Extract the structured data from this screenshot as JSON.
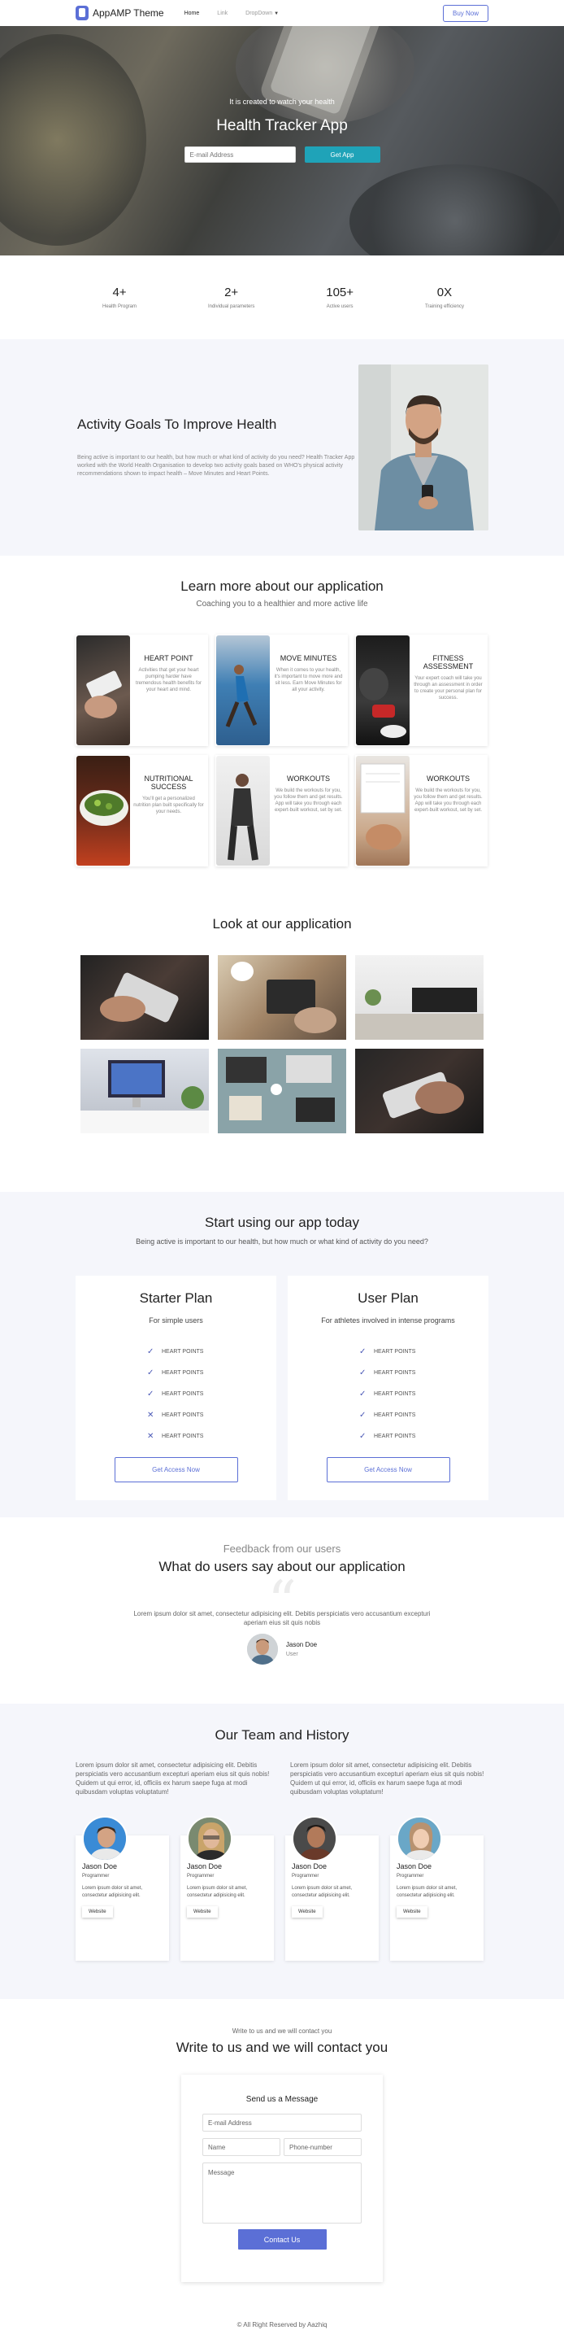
{
  "nav": {
    "brand": "AppAMP Theme",
    "links": [
      "Home",
      "Link",
      "DropDown"
    ],
    "buy_label": "Buy Now"
  },
  "hero": {
    "subtitle": "It is created to watch your health",
    "title": "Health Tracker App",
    "email_placeholder": "E-mail Address",
    "button": "Get App"
  },
  "stats": [
    {
      "value": "4+",
      "label": "Health Program"
    },
    {
      "value": "2+",
      "label": "Individual parameters"
    },
    {
      "value": "105+",
      "label": "Active users"
    },
    {
      "value": "0X",
      "label": "Training efficiency"
    }
  ],
  "activity": {
    "title": "Activity Goals To Improve Health",
    "text": "Being active is important to our health, but how much or what kind of activity do you need? Health Tracker App worked with the World Health Organisation to develop two activity goals based on WHO's physical activity recommendations shown to impact health – Move Minutes and Heart Points."
  },
  "learn": {
    "title": "Learn more about our application",
    "subtitle": "Coaching you to a healthier and more active life",
    "cards": [
      {
        "title": "HEART POINT",
        "text": "Activities that get your heart pumping harder have tremendous health benefits for your heart and mind."
      },
      {
        "title": "MOVE MINUTES",
        "text": "When it comes to your health, it's important to move more and sit less. Earn Move Minutes for all your activity."
      },
      {
        "title": "FITNESS ASSESSMENT",
        "text": "Your expert coach will take you through an assessment in order to create your personal plan for success."
      },
      {
        "title": "NUTRITIONAL SUCCESS",
        "text": "You'll get a personalized nutrition plan built specifically for your needs."
      },
      {
        "title": "WORKOUTS",
        "text": "We build the workouts for you, you follow them and get results. App will take you through each expert-built workout, set by set."
      },
      {
        "title": "WORKOUTS",
        "text": "We build the workouts for you, you follow them and get results. App will take you through each expert-built workout, set by set."
      }
    ]
  },
  "gallery": {
    "title": "Look at our application"
  },
  "pricing": {
    "title": "Start using our app today",
    "subtitle": "Being active is important to our health, but how much or what kind of activity do you need?",
    "plans": [
      {
        "name": "Starter Plan",
        "audience": "For simple users",
        "features": [
          {
            "label": "HEART POINTS",
            "included": true
          },
          {
            "label": "HEART POINTS",
            "included": true
          },
          {
            "label": "HEART POINTS",
            "included": true
          },
          {
            "label": "HEART POINTS",
            "included": false
          },
          {
            "label": "HEART POINTS",
            "included": false
          }
        ],
        "button": "Get Access Now"
      },
      {
        "name": "User Plan",
        "audience": "For athletes involved in intense programs",
        "features": [
          {
            "label": "HEART POINTS",
            "included": true
          },
          {
            "label": "HEART POINTS",
            "included": true
          },
          {
            "label": "HEART POINTS",
            "included": true
          },
          {
            "label": "HEART POINTS",
            "included": true
          },
          {
            "label": "HEART POINTS",
            "included": true
          }
        ],
        "button": "Get Access Now"
      }
    ]
  },
  "feedback": {
    "label": "Feedback from our users",
    "title": "What do users say about our application",
    "quote": "Lorem ipsum dolor sit amet, consectetur adipisicing elit. Debitis perspiciatis vero accusantium excepturi aperiam eius sit quis nobis",
    "name": "Jason Doe",
    "role": "User"
  },
  "team": {
    "title": "Our Team and History",
    "col1": "Lorem ipsum dolor sit amet, consectetur adipisicing elit. Debitis perspiciatis vero accusantium excepturi aperiam eius sit quis nobis! Quidem ut qui error, id, officiis ex harum saepe fuga at modi quibusdam voluptas voluptatum!",
    "col2": "Lorem ipsum dolor sit amet, consectetur adipisicing elit. Debitis perspiciatis vero accusantium excepturi aperiam eius sit quis nobis! Quidem ut qui error, id, officiis ex harum saepe fuga at modi quibusdam voluptas voluptatum!",
    "members": [
      {
        "name": "Jason Doe",
        "role": "Programmer",
        "text": "Lorem ipsum dolor sit amet, consectetur adipisicing elit.",
        "button": "Website"
      },
      {
        "name": "Jason Doe",
        "role": "Programmer",
        "text": "Lorem ipsum dolor sit amet, consectetur adipisicing elit.",
        "button": "Website"
      },
      {
        "name": "Jason Doe",
        "role": "Programmer",
        "text": "Lorem ipsum dolor sit amet, consectetur adipisicing elit.",
        "button": "Website"
      },
      {
        "name": "Jason Doe",
        "role": "Programmer",
        "text": "Lorem ipsum dolor sit amet, consectetur adipisicing elit.",
        "button": "Website"
      }
    ]
  },
  "contact": {
    "label": "Write to us and we will contact you",
    "title": "Write to us and we will contact you",
    "form_title": "Send us a Message",
    "email_placeholder": "E-mail Address",
    "name_placeholder": "Name",
    "phone_placeholder": "Phone-number",
    "message_placeholder": "Message",
    "button": "Contact Us"
  },
  "footer": {
    "text": "© All Right Reserved by Aazhiq"
  }
}
